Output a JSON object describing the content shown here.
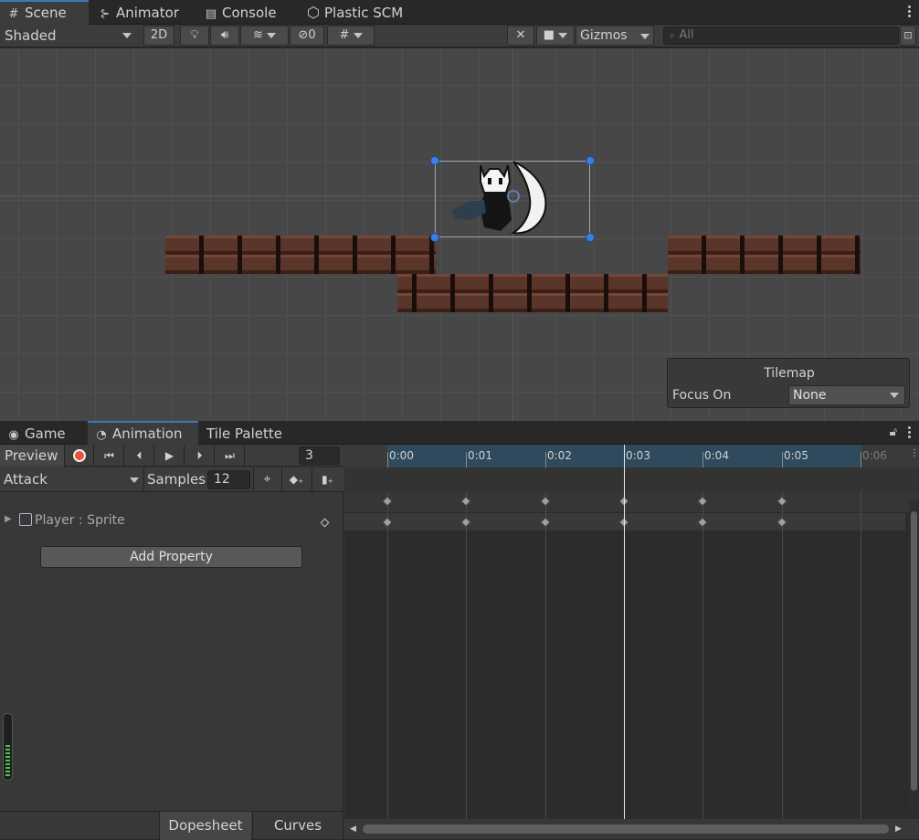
{
  "top_tabs": [
    {
      "label": "Scene",
      "icon": "hash-grid-icon"
    },
    {
      "label": "Animator",
      "icon": "animator-icon"
    },
    {
      "label": "Console",
      "icon": "console-icon"
    },
    {
      "label": "Plastic SCM",
      "icon": "plastic-scm-icon"
    }
  ],
  "scene_toolbar": {
    "shading_mode": "Shaded",
    "mode_2d": "2D",
    "hidden_count": "0",
    "gizmos": "Gizmos",
    "search_placeholder": "All"
  },
  "tilemap_overlay": {
    "title": "Tilemap",
    "focus_label": "Focus On",
    "focus_value": "None"
  },
  "bottom_tabs": [
    {
      "label": "Game",
      "icon": "gamepad-icon"
    },
    {
      "label": "Animation",
      "icon": "animation-clock-icon"
    },
    {
      "label": "Tile Palette",
      "icon": ""
    }
  ],
  "animation": {
    "preview_label": "Preview",
    "frame": "3",
    "clip": "Attack",
    "samples_label": "Samples",
    "samples": "12",
    "property": "Player : Sprite",
    "add_property": "Add Property",
    "dopesheet": "Dopesheet",
    "curves": "Curves",
    "time_labels": [
      "0:00",
      "0:01",
      "0:02",
      "0:03",
      "0:04",
      "0:05",
      "0:06"
    ],
    "keyframe_count": 6,
    "current_frame_index": 3
  },
  "colors": {
    "accent": "#3a79bb",
    "record": "#e8533a",
    "timeline_blue": "#2e4a5c",
    "meter_green": "#49c549"
  }
}
